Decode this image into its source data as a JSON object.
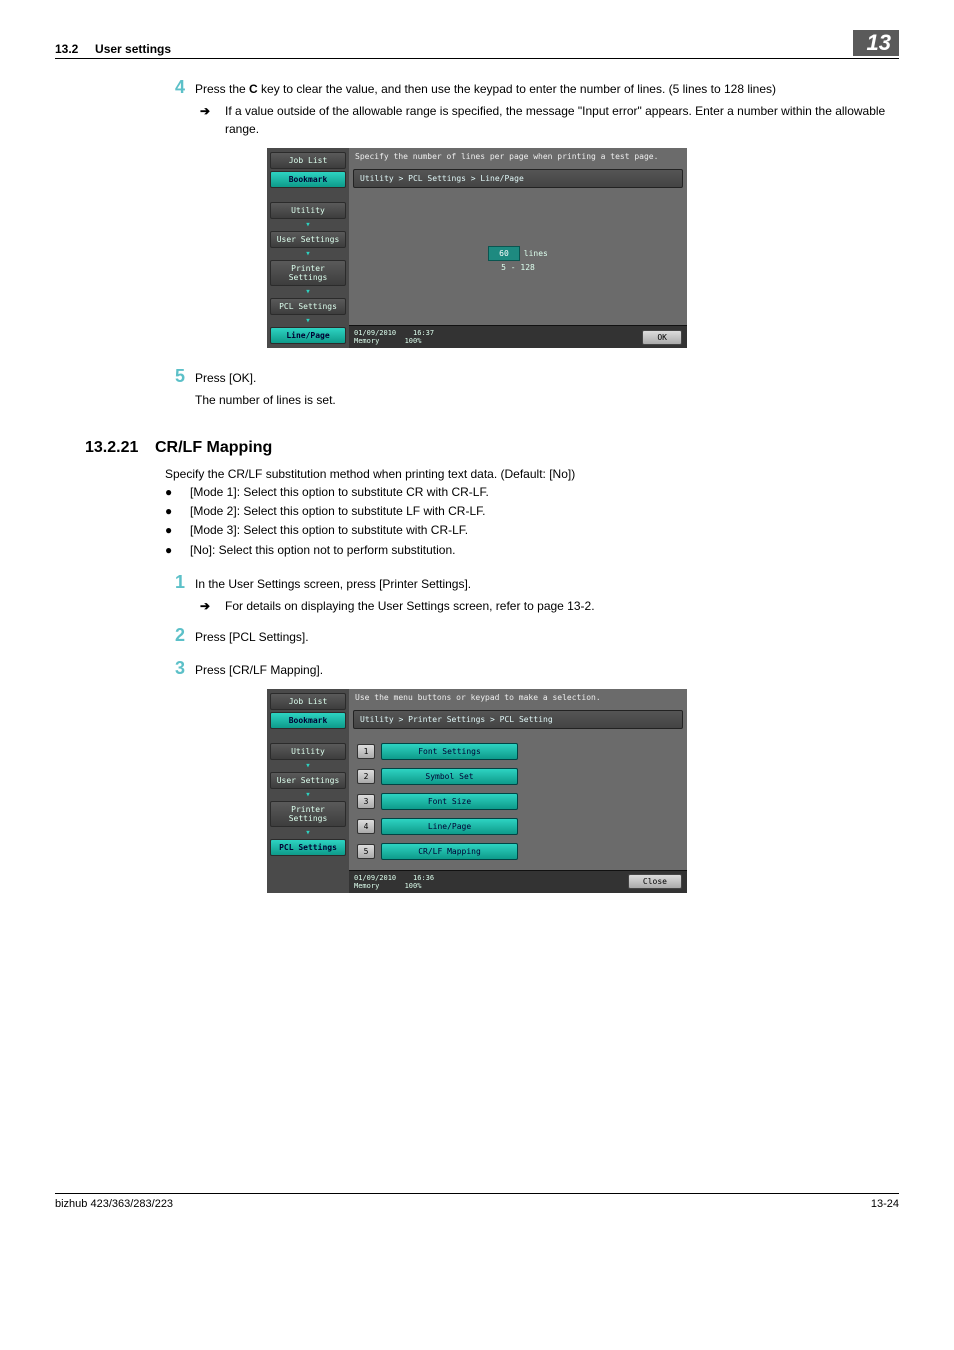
{
  "header": {
    "section_num": "13.2",
    "section_title": "User settings",
    "chapter_badge": "13"
  },
  "step4": {
    "num": "4",
    "text_a": "Press the ",
    "text_bold": "C",
    "text_b": " key to clear the value, and then use the keypad to enter the number of lines. (5 lines to 128 lines)",
    "arrow": "If a value outside of the allowable range is specified, the message \"Input error\" appears. Enter a number within the allowable range."
  },
  "screen1": {
    "left": {
      "job_list": "Job List",
      "bookmark": "Bookmark",
      "utility": "Utility",
      "user_settings": "User Settings",
      "printer_settings": "Printer Settings",
      "pcl_settings": "PCL Settings",
      "line_page": "Line/Page"
    },
    "top_msg": "Specify the number of lines per page when printing a test page.",
    "path": "Utility > PCL Settings > Line/Page",
    "value": "60",
    "value_unit": "lines",
    "range": "5 - 128",
    "date": "01/09/2010",
    "time": "16:37",
    "mem_label": "Memory",
    "mem_val": "100%",
    "ok": "OK"
  },
  "step5": {
    "num": "5",
    "text": "Press [OK].",
    "after": "The number of lines is set."
  },
  "section": {
    "num": "13.2.21",
    "title": "CR/LF Mapping",
    "intro": "Specify the CR/LF substitution method when printing text data. (Default: [No])",
    "bullets": [
      "[Mode 1]: Select this option to substitute CR with CR-LF.",
      "[Mode 2]: Select this option to substitute LF with CR-LF.",
      "[Mode 3]: Select this option to substitute with CR-LF.",
      "[No]: Select this option not to perform substitution."
    ]
  },
  "step_b1": {
    "num": "1",
    "text": "In the User Settings screen, press [Printer Settings].",
    "arrow": "For details on displaying the User Settings screen, refer to page 13-2."
  },
  "step_b2": {
    "num": "2",
    "text": "Press [PCL Settings]."
  },
  "step_b3": {
    "num": "3",
    "text": "Press [CR/LF Mapping]."
  },
  "screen2": {
    "left": {
      "job_list": "Job List",
      "bookmark": "Bookmark",
      "utility": "Utility",
      "user_settings": "User Settings",
      "printer_settings": "Printer Settings",
      "pcl_settings": "PCL Settings"
    },
    "top_msg": "Use the menu buttons or keypad to make a selection.",
    "path": "Utility > Printer Settings > PCL Setting",
    "items": [
      {
        "n": "1",
        "label": "Font Settings"
      },
      {
        "n": "2",
        "label": "Symbol Set"
      },
      {
        "n": "3",
        "label": "Font Size"
      },
      {
        "n": "4",
        "label": "Line/Page"
      },
      {
        "n": "5",
        "label": "CR/LF Mapping"
      }
    ],
    "date": "01/09/2010",
    "time": "16:36",
    "mem_label": "Memory",
    "mem_val": "100%",
    "close": "Close"
  },
  "footer": {
    "left": "bizhub 423/363/283/223",
    "right": "13-24"
  }
}
